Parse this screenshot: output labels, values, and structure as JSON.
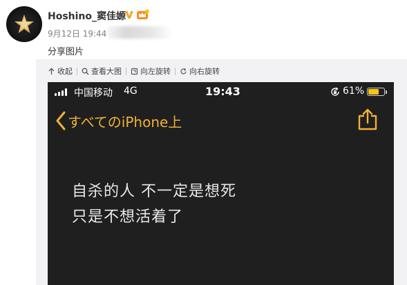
{
  "post": {
    "username": "Hoshino_窦佳嫄",
    "date": "9月12日 19:44",
    "text": "分享图片"
  },
  "toolbar": {
    "collapse_label": "收起",
    "view_large_label": "查看大图",
    "rotate_left_label": "向左旋转",
    "rotate_right_label": "向右旋转"
  },
  "phone": {
    "carrier": "中国移动",
    "network": "4G",
    "time": "19:43",
    "battery_percent": "61%",
    "battery_level": 0.61,
    "back_label": "すべてのiPhone上",
    "note_lines": [
      "自杀的人 不一定是想死",
      "只是不想活着了"
    ]
  },
  "colors": {
    "accent": "#f2b134",
    "vip": "#f5a623",
    "phone_bg": "#1f1f1f",
    "panel_bg": "#f2f2f5"
  }
}
